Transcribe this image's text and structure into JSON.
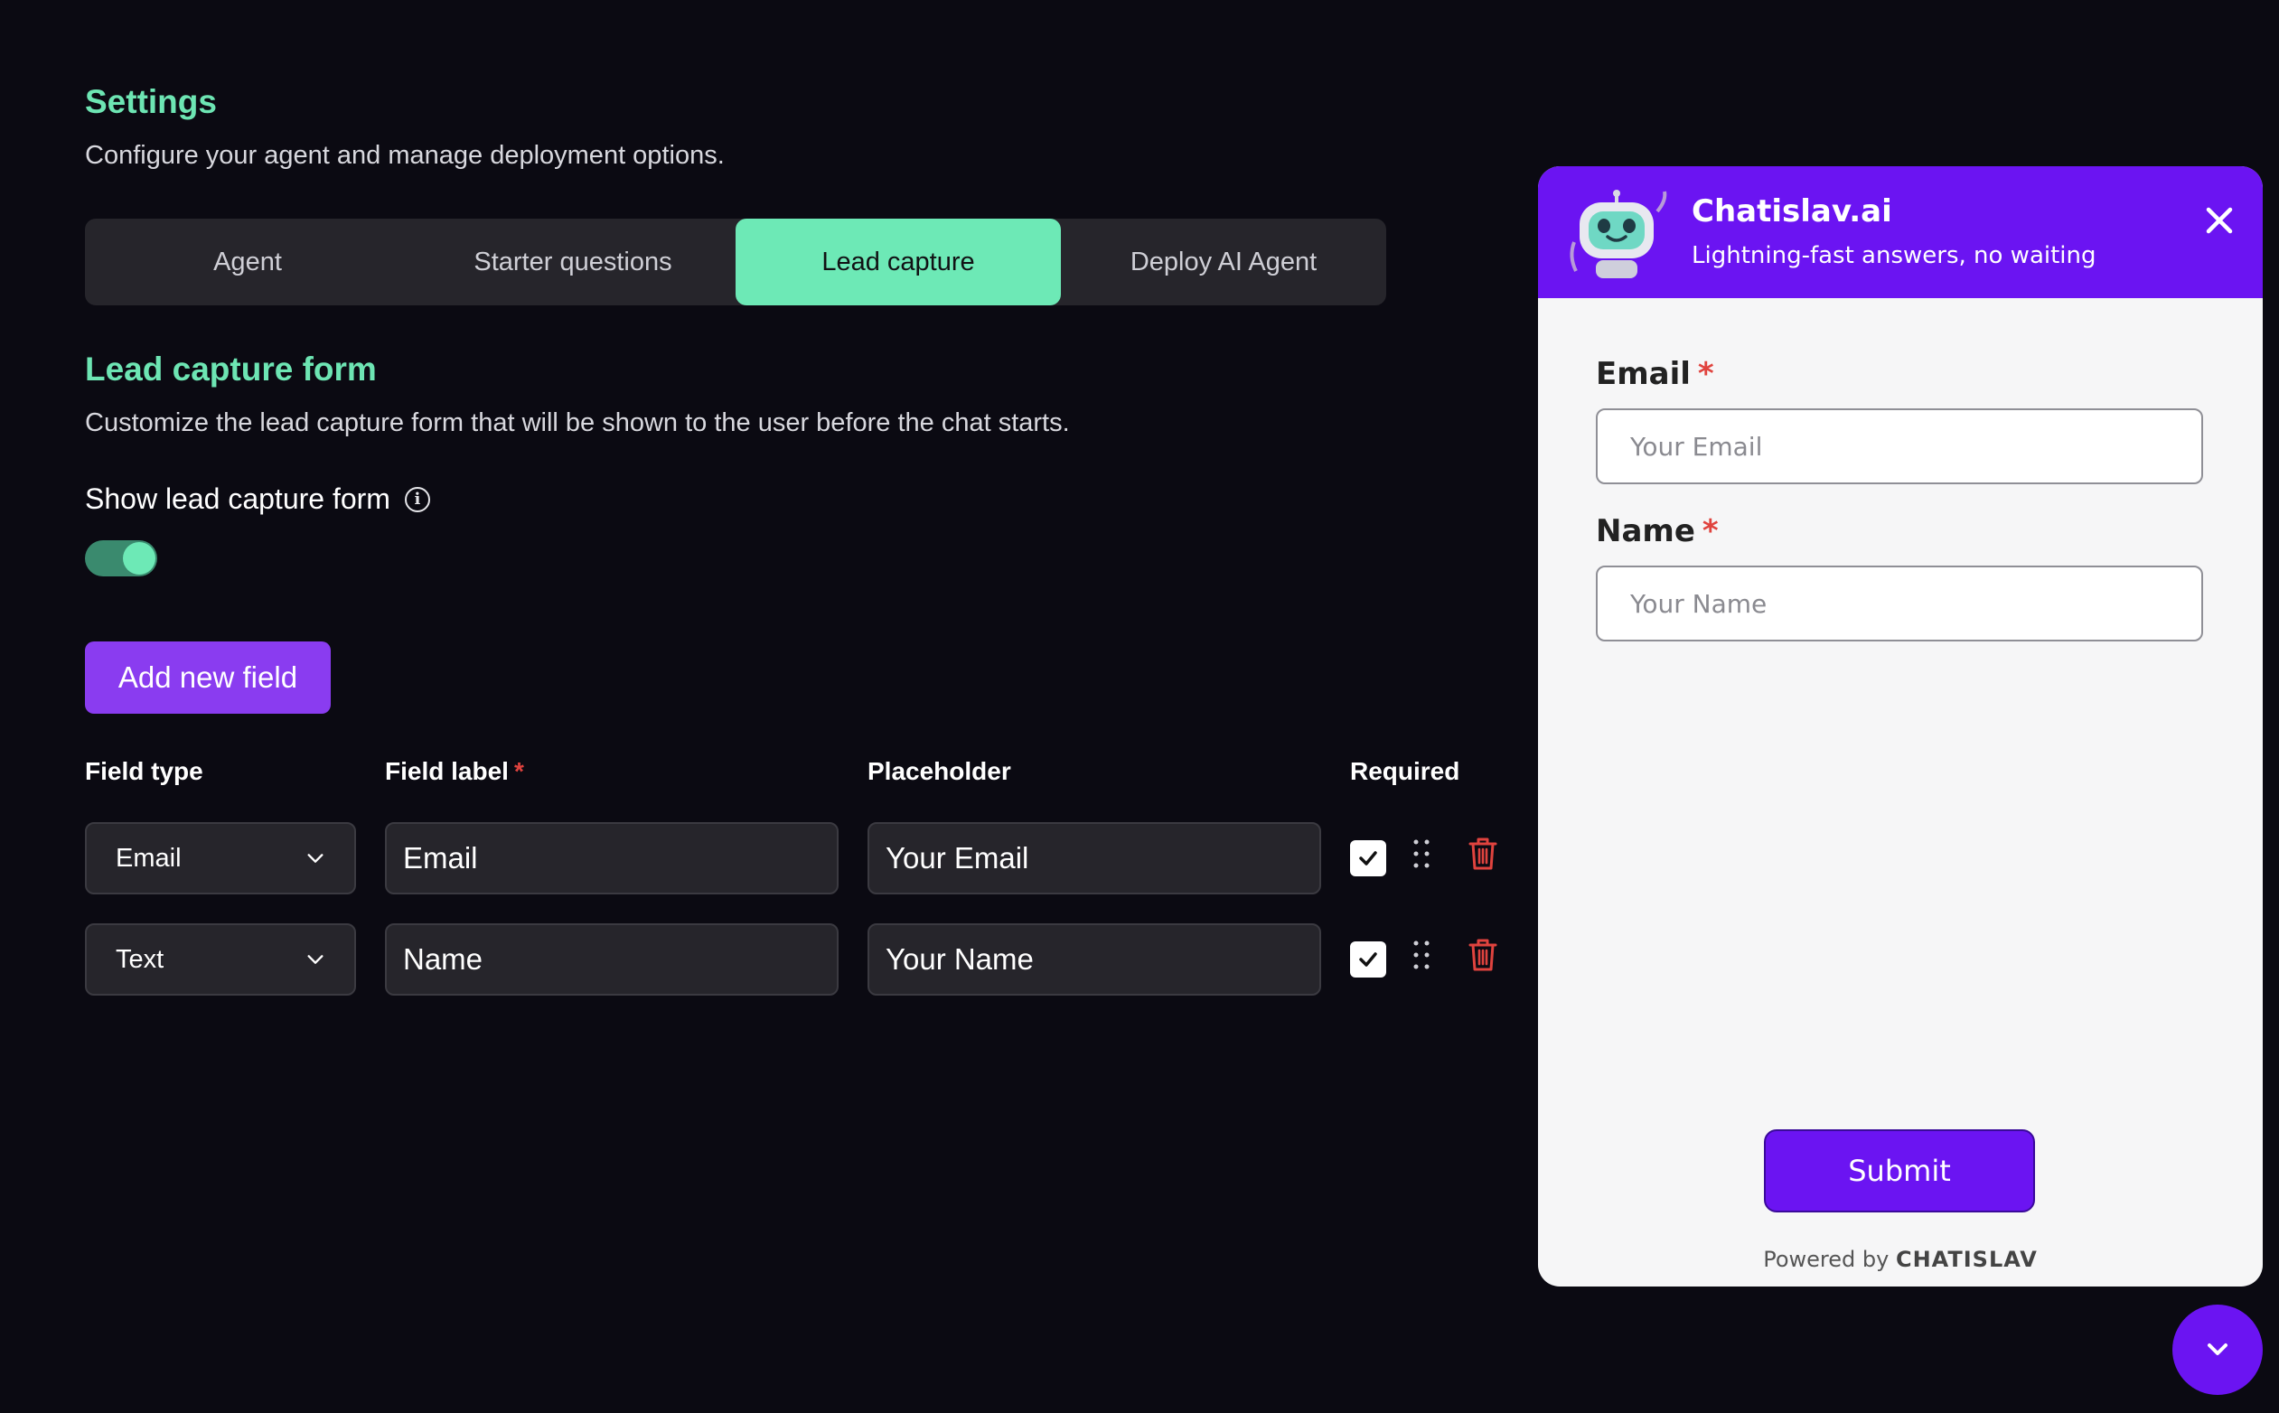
{
  "settings": {
    "title": "Settings",
    "subtitle": "Configure your agent and manage deployment options."
  },
  "tabs": [
    {
      "label": "Agent",
      "active": false
    },
    {
      "label": "Starter questions",
      "active": false
    },
    {
      "label": "Lead capture",
      "active": true
    },
    {
      "label": "Deploy AI Agent",
      "active": false
    }
  ],
  "lead_form": {
    "title": "Lead capture form",
    "description": "Customize the lead capture form that will be shown to the user before the chat starts.",
    "toggle_label": "Show lead capture form",
    "toggle_on": true,
    "add_button": "Add new field",
    "columns": {
      "field_type": "Field type",
      "field_label": "Field label",
      "field_label_required_mark": "*",
      "placeholder": "Placeholder",
      "required": "Required"
    },
    "fields": [
      {
        "type": "Email",
        "label": "Email",
        "placeholder": "Your Email",
        "required": true
      },
      {
        "type": "Text",
        "label": "Name",
        "placeholder": "Your Name",
        "required": true
      }
    ]
  },
  "widget": {
    "name": "Chatislav.ai",
    "tagline": "Lightning-fast answers, no waiting",
    "fields": [
      {
        "label": "Email",
        "required_mark": "*",
        "placeholder": "Your Email"
      },
      {
        "label": "Name",
        "required_mark": "*",
        "placeholder": "Your Name"
      }
    ],
    "submit_label": "Submit",
    "powered_prefix": "Powered by",
    "powered_brand": "CHATISLAV"
  },
  "colors": {
    "background": "#0b0a12",
    "accent_green": "#6de9b6",
    "accent_purple": "#8a3cf0",
    "widget_purple": "#6b14f2",
    "danger": "#e0433e"
  },
  "icons": [
    "info-icon",
    "chevron-down-icon",
    "check-icon",
    "drag-handle-icon",
    "trash-icon",
    "close-icon",
    "robot-avatar-icon",
    "chevron-down-fab-icon"
  ]
}
